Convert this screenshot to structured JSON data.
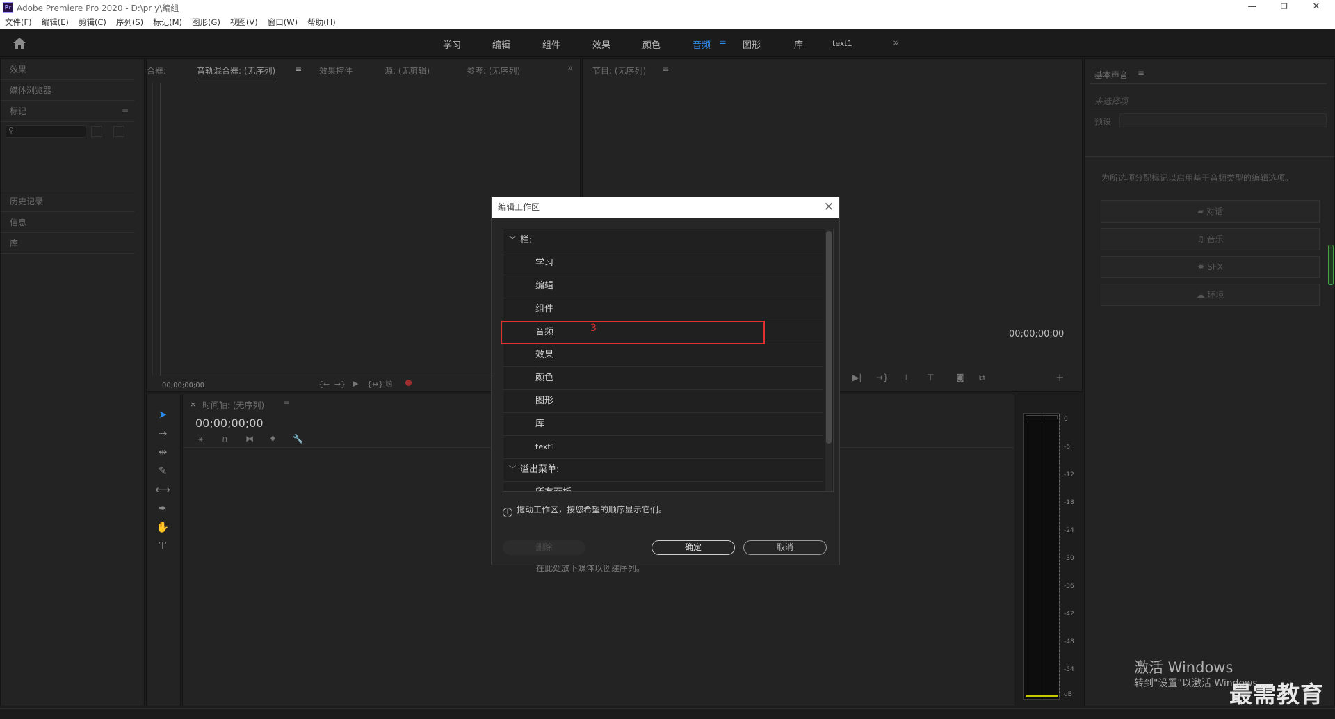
{
  "window": {
    "title": "Adobe Premiere Pro 2020 - D:\\pr y\\编组",
    "app_icon": "Pr",
    "controls": [
      "—",
      "❐",
      "✕"
    ]
  },
  "menu": [
    "文件(F)",
    "编辑(E)",
    "剪辑(C)",
    "序列(S)",
    "标记(M)",
    "图形(G)",
    "视图(V)",
    "窗口(W)",
    "帮助(H)"
  ],
  "workspaces": {
    "tabs": [
      "学习",
      "编辑",
      "组件",
      "效果",
      "颜色",
      "音频",
      "图形",
      "库",
      "text1"
    ],
    "active": "音频",
    "more": "»"
  },
  "left_panel": {
    "effects": "效果",
    "media_browser": "媒体浏览器",
    "markers": "标记",
    "history": "历史记录",
    "info": "信息",
    "library": "库"
  },
  "source_panel": {
    "tab_prefix": "合器:",
    "mixer": "音轨混合器: (无序列)",
    "effect_controls": "效果控件",
    "source": "源: (无剪辑)",
    "reference": "参考: (无序列)",
    "timecode": "00;00;00;00"
  },
  "program_panel": {
    "title": "节目: (无序列)",
    "timecode": "00;00;00;00"
  },
  "timeline": {
    "title": "时间轴: (无序列)",
    "timecode": "00;00;00;00",
    "hint": "在此处放下媒体以创建序列。"
  },
  "essential_sound": {
    "title": "基本声音",
    "no_selection": "未选择项",
    "preset_label": "预设",
    "hint": "为所选项分配标记以启用基于音频类型的编辑选项。",
    "buttons": [
      "对话",
      "音乐",
      "SFX",
      "环境"
    ]
  },
  "meter": {
    "labels": [
      "0",
      "-6",
      "-12",
      "-18",
      "-24",
      "-30",
      "-36",
      "-42",
      "-48",
      "-54",
      "dB"
    ]
  },
  "dialog": {
    "title": "编辑工作区",
    "close": "✕",
    "group_bar": "栏:",
    "bar_items": [
      "学习",
      "编辑",
      "组件",
      "音频",
      "效果",
      "颜色",
      "图形",
      "库",
      "text1"
    ],
    "group_overflow": "溢出菜单:",
    "overflow_first": "所有面板",
    "annotation": "3",
    "info_icon": "i",
    "info": "拖动工作区，按您希望的顺序显示它们。",
    "delete": "删除",
    "ok": "确定",
    "cancel": "取消"
  },
  "watermark": {
    "line1": "激活 Windows",
    "line2": "转到\"设置\"以激活 Windows。",
    "brand": "最需教育"
  }
}
